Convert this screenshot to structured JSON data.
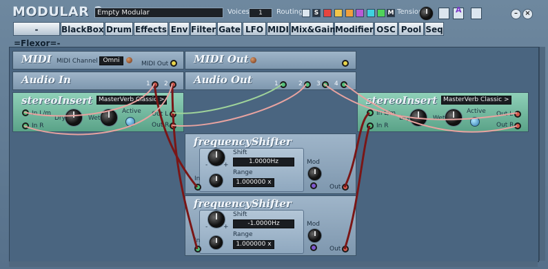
{
  "app": {
    "title": "MODULAR 2",
    "preset": "Empty Modular",
    "voices_label": "Voices",
    "voices_value": "1",
    "routing_label": "Routing",
    "routing_s": "S",
    "routing_m": "M",
    "tension_label": "Tension",
    "routing_colors": [
      "#e6453f",
      "#f2c54a",
      "#f0a03c",
      "#b85ad6",
      "#3fd2e0",
      "#50d25a"
    ],
    "help_icon": "A"
  },
  "categories": [
    "-=Flexor=-",
    "BlackBox",
    "Drum",
    "Effects",
    "Env",
    "Filter",
    "Gate",
    "LFO",
    "MIDI",
    "Mix&Gain",
    "Modifier",
    "OSC",
    "Pool",
    "Seq"
  ],
  "modules": {
    "midi": {
      "name": "MIDI",
      "channel_label": "MIDI Channel",
      "channel_value": "Omni",
      "out_label": "MIDI Out"
    },
    "midiout": {
      "name": "MIDI Out"
    },
    "audioin": {
      "name": "Audio In",
      "ports": [
        "1",
        "2"
      ]
    },
    "audioout": {
      "name": "Audio Out",
      "ports": [
        "1",
        "2",
        "3",
        "4"
      ]
    },
    "insert1": {
      "name": "stereoInsert",
      "plugin": "MasterVerb Classic >",
      "inl": "In L/m",
      "inr": "In R",
      "dry": "Dry",
      "wet": "Wet",
      "active": "Active",
      "outl": "Out L",
      "outr": "Out R"
    },
    "insert2": {
      "name": "stereoInsert",
      "plugin": "MasterVerb Classic >",
      "inl": "In L/m",
      "inr": "In R",
      "dry": "Dry",
      "wet": "Wet",
      "active": "Active",
      "outl": "Out L",
      "outr": "Out R"
    },
    "fs1": {
      "name": "frequencyShifter",
      "shift_label": "Shift",
      "shift_value": "1.0000Hz",
      "range_label": "Range",
      "range_value": "1.000000 x",
      "mod_label": "Mod",
      "in_label": "In",
      "out_label": "Out",
      "minus": "-",
      "plus": "+"
    },
    "fs2": {
      "name": "frequencyShifter",
      "shift_label": "Shift",
      "shift_value": "-1.0000Hz",
      "range_label": "Range",
      "range_value": "1.000000 x",
      "mod_label": "Mod",
      "in_label": "In",
      "out_label": "Out",
      "minus": "-",
      "plus": "+"
    }
  },
  "cable_colors": {
    "red": "#7a1616",
    "pink": "#e8a3a0",
    "green": "#9fd39a"
  }
}
